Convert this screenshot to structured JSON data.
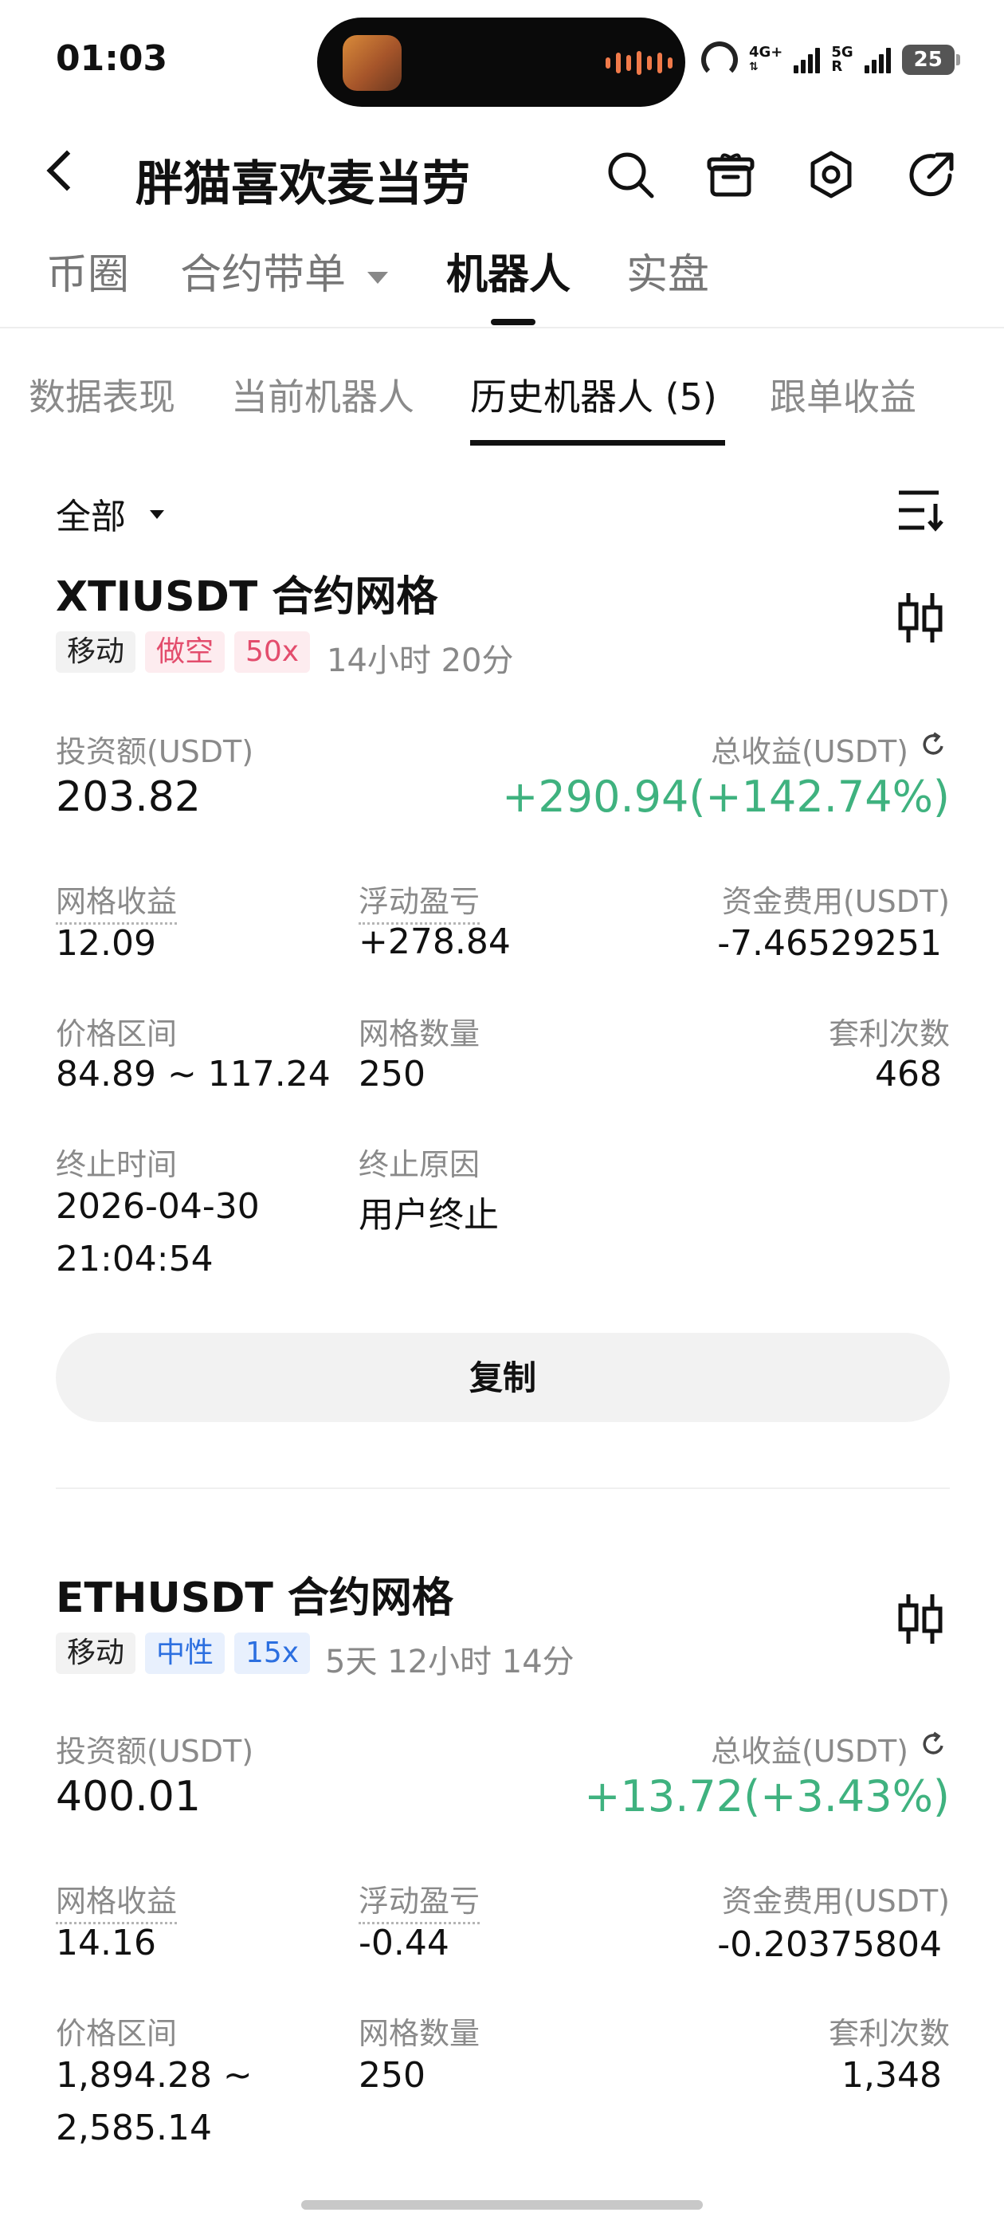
{
  "status_bar": {
    "time": "01:03",
    "net_4g": "4G+",
    "net_5g": "5G",
    "net_r": "R",
    "battery": "25"
  },
  "header": {
    "title": "胖猫喜欢麦当劳",
    "icons": [
      "search-icon",
      "gift-icon",
      "settings-icon",
      "share-icon"
    ]
  },
  "main_tabs": [
    {
      "label": "币圈"
    },
    {
      "label": "合约带单"
    },
    {
      "label": "机器人"
    },
    {
      "label": "实盘"
    }
  ],
  "sub_tabs": [
    {
      "label": "数据表现"
    },
    {
      "label": "当前机器人"
    },
    {
      "label": "历史机器人 (5)"
    },
    {
      "label": "跟单收益"
    }
  ],
  "filter": {
    "label": "全部"
  },
  "cards": [
    {
      "title": "XTIUSDT 合约网格",
      "tags": [
        "移动",
        "做空",
        "50x"
      ],
      "duration": "14小时 20分",
      "invest_label": "投资额(USDT)",
      "invest_value": "203.82",
      "total_label": "总收益(USDT)",
      "total_value": "+290.94(+142.74%)",
      "grid_profit_label": "网格收益",
      "grid_profit": "12.09",
      "floating_label": "浮动盈亏",
      "floating": "+278.84",
      "funding_label": "资金费用(USDT)",
      "funding": "-7.46529251",
      "range_label": "价格区间",
      "range_line1": "84.89 ~ 117.24",
      "grid_count_label": "网格数量",
      "grid_count": "250",
      "arb_label": "套利次数",
      "arb_count": "468",
      "end_time_label": "终止时间",
      "end_date": "2026-04-30",
      "end_clock": "21:04:54",
      "end_reason_label": "终止原因",
      "end_reason": "用户终止",
      "copy_label": "复制"
    },
    {
      "title": "ETHUSDT 合约网格",
      "tags": [
        "移动",
        "中性",
        "15x"
      ],
      "duration": "5天 12小时 14分",
      "invest_label": "投资额(USDT)",
      "invest_value": "400.01",
      "total_label": "总收益(USDT)",
      "total_value": "+13.72(+3.43%)",
      "grid_profit_label": "网格收益",
      "grid_profit": "14.16",
      "floating_label": "浮动盈亏",
      "floating": "-0.44",
      "funding_label": "资金费用(USDT)",
      "funding": "-0.20375804",
      "range_label": "价格区间",
      "range_line1": "1,894.28 ~",
      "range_line2": "2,585.14",
      "grid_count_label": "网格数量",
      "grid_count": "250",
      "arb_label": "套利次数",
      "arb_count": "1,348"
    }
  ],
  "colors": {
    "profit_green": "#3fb27f",
    "short_red": "#e34d6d",
    "neutral_blue": "#2c6fe0"
  }
}
